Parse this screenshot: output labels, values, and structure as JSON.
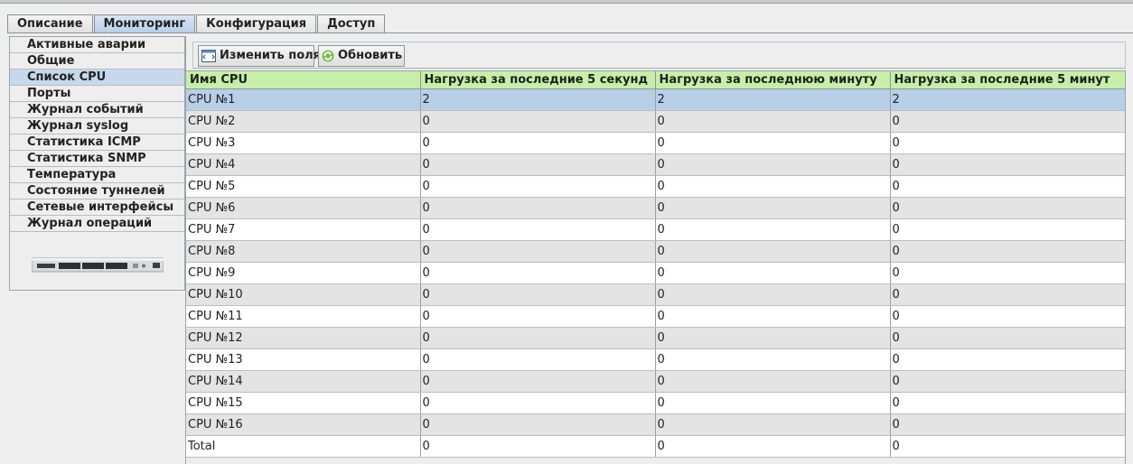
{
  "tabs": [
    {
      "label": "Описание",
      "active": false
    },
    {
      "label": "Мониторинг",
      "active": true
    },
    {
      "label": "Конфигурация",
      "active": false
    },
    {
      "label": "Доступ",
      "active": false
    }
  ],
  "sidebar": {
    "items": [
      {
        "label": "Активные аварии"
      },
      {
        "label": "Общие"
      },
      {
        "label": "Список CPU",
        "active": true
      },
      {
        "label": "Порты"
      },
      {
        "label": "Журнал событий"
      },
      {
        "label": "Журнал syslog"
      },
      {
        "label": "Статистика ICMP"
      },
      {
        "label": "Статистика SNMP"
      },
      {
        "label": "Температура"
      },
      {
        "label": "Состояние туннелей"
      },
      {
        "label": "Сетевые интерфейсы"
      },
      {
        "label": "Журнал операций"
      }
    ]
  },
  "toolbar": {
    "edit_fields_label": "Изменить поля",
    "refresh_label": "Обновить"
  },
  "table": {
    "columns": [
      "Имя CPU",
      "Нагрузка за последние 5 секунд",
      "Нагрузка за последнюю минуту",
      "Нагрузка за последние 5 минут"
    ],
    "rows": [
      [
        "CPU №1",
        "2",
        "2",
        "2"
      ],
      [
        "CPU №2",
        "0",
        "0",
        "0"
      ],
      [
        "CPU №3",
        "0",
        "0",
        "0"
      ],
      [
        "CPU №4",
        "0",
        "0",
        "0"
      ],
      [
        "CPU №5",
        "0",
        "0",
        "0"
      ],
      [
        "CPU №6",
        "0",
        "0",
        "0"
      ],
      [
        "CPU №7",
        "0",
        "0",
        "0"
      ],
      [
        "CPU №8",
        "0",
        "0",
        "0"
      ],
      [
        "CPU №9",
        "0",
        "0",
        "0"
      ],
      [
        "CPU №10",
        "0",
        "0",
        "0"
      ],
      [
        "CPU №11",
        "0",
        "0",
        "0"
      ],
      [
        "CPU №12",
        "0",
        "0",
        "0"
      ],
      [
        "CPU №13",
        "0",
        "0",
        "0"
      ],
      [
        "CPU №14",
        "0",
        "0",
        "0"
      ],
      [
        "CPU №15",
        "0",
        "0",
        "0"
      ],
      [
        "CPU №16",
        "0",
        "0",
        "0"
      ],
      [
        "Total",
        "0",
        "0",
        "0"
      ]
    ],
    "selected_row": 0
  },
  "colors": {
    "header_bg": "#c6f0a8",
    "selected_row": "#b8cfe8",
    "active_tab": "#c8d8ec"
  },
  "icons": {
    "edit_fields": "edit-fields-icon",
    "refresh": "refresh-icon",
    "device": "network-switch-icon"
  }
}
